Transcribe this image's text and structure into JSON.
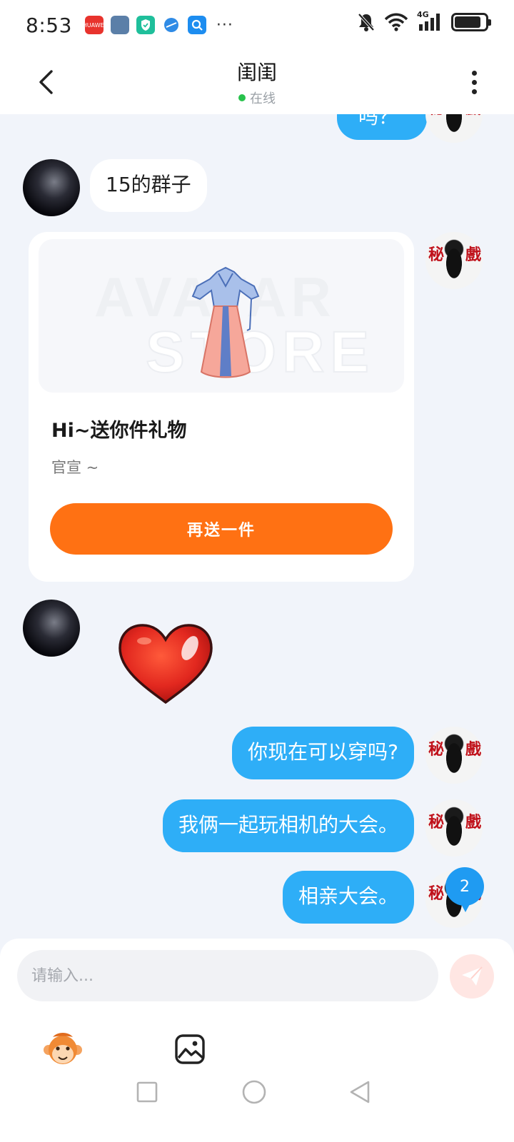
{
  "status_bar": {
    "time": "8:53",
    "network": "4G",
    "battery_level": 0.85,
    "apps": [
      {
        "icon": "huawei-app-icon",
        "color": "#e8332d",
        "label": "HUAWEI"
      },
      {
        "icon": "photo-app-icon",
        "color": "#5b7fa8",
        "label": ""
      },
      {
        "icon": "shield-app-icon",
        "color": "#1fbf9b",
        "label": ""
      },
      {
        "icon": "browser-app-icon",
        "color": "#2f8be6",
        "label": ""
      },
      {
        "icon": "search-app-icon",
        "color": "#1d8df0",
        "label": ""
      }
    ],
    "more": "···"
  },
  "header": {
    "title": "闺闺",
    "status": "在线"
  },
  "messages": [
    {
      "side": "out",
      "text": "吗？"
    },
    {
      "side": "in",
      "text": "15的群子"
    },
    {
      "side": "in",
      "type": "gift-card"
    },
    {
      "side": "in",
      "type": "sticker",
      "sticker": "heart"
    },
    {
      "side": "out",
      "text": "你现在可以穿吗?"
    },
    {
      "side": "out",
      "text": "我俩一起玩相机的大会。"
    },
    {
      "side": "out",
      "text": "相亲大会。"
    }
  ],
  "gift_card": {
    "watermark_top": "AVATAR",
    "watermark_bottom": "STORE",
    "title": "Hi~送你件礼物",
    "subtitle": "官宣 ~",
    "button_label": "再送一件"
  },
  "self_avatar_seal": [
    "秘",
    "戲"
  ],
  "unread_count": "2",
  "input": {
    "placeholder": "请输入..."
  },
  "colors": {
    "accent_blue": "#2eaef7",
    "gift_button": "#ff7113",
    "online": "#27c24c"
  }
}
